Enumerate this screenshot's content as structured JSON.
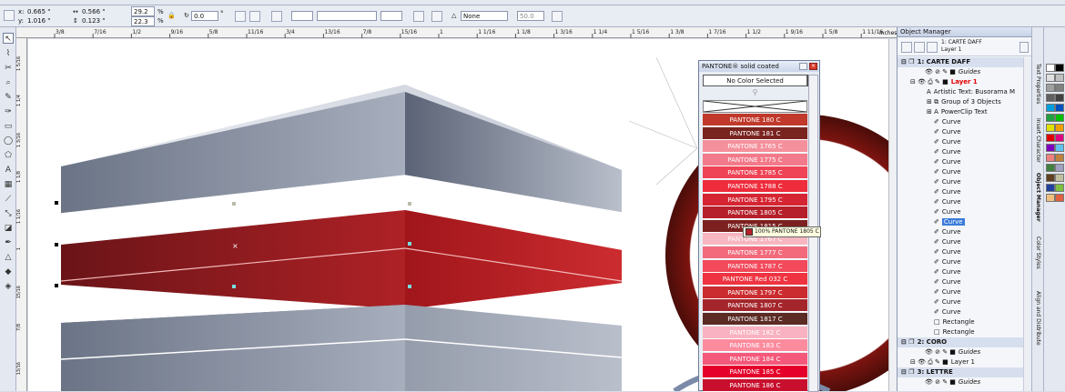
{
  "propbar": {
    "x_label": "x:",
    "x_value": "0.665 \"",
    "y_label": "y:",
    "y_value": "1.016 \"",
    "w_value": "0.566 \"",
    "h_value": "0.123 \"",
    "scale_w": "29.2",
    "scale_h": "22.3",
    "pct1": "%",
    "pct2": "%",
    "rotation": "0.0",
    "deg": "°",
    "outline_value": "None",
    "opacity_value": "50.0"
  },
  "ruler": {
    "units": "inches",
    "ticks": [
      "3/8",
      "7/16",
      "1/2",
      "9/16",
      "5/8",
      "11/16",
      "3/4",
      "13/16",
      "7/8",
      "15/16",
      "1",
      "1 1/16",
      "1 1/8",
      "1 3/16",
      "1 1/4",
      "1 5/16",
      "1 3/8",
      "1 7/16",
      "1 1/2",
      "1 9/16",
      "1 5/8",
      "1 11/16"
    ],
    "left_ticks": [
      "1 5/16",
      "1 1/4",
      "1 3/16",
      "1 1/8",
      "1 1/16",
      "1",
      "15/16",
      "7/8",
      "13/16"
    ]
  },
  "toolbox": {
    "tools": [
      "pick-tool",
      "shape-tool",
      "crop-tool",
      "zoom-tool",
      "freehand-tool",
      "smart-fill-tool",
      "rectangle-tool",
      "ellipse-tool",
      "polygon-tool",
      "text-tool",
      "table-tool",
      "dimension-tool",
      "connector-tool",
      "interactive-tool",
      "eyedropper-tool",
      "outline-tool",
      "fill-tool",
      "interactive-fill-tool"
    ]
  },
  "object_manager": {
    "title": "Object Manager",
    "current_page": "1: CARTE DAFF",
    "current_layer": "Layer 1",
    "tree": [
      {
        "type": "page",
        "label": "1: CARTE DAFF"
      },
      {
        "type": "guides",
        "label": "Guides"
      },
      {
        "type": "layer",
        "label": "Layer 1",
        "color": "#e00000"
      },
      {
        "type": "item",
        "label": "Artistic Text: Busorama M",
        "icon": "A"
      },
      {
        "type": "item",
        "label": "Group of 3 Objects",
        "icon": "G"
      },
      {
        "type": "item",
        "label": "PowerClip Text",
        "icon": "A"
      },
      {
        "type": "curve",
        "label": "Curve"
      },
      {
        "type": "curve",
        "label": "Curve"
      },
      {
        "type": "curve",
        "label": "Curve"
      },
      {
        "type": "curve",
        "label": "Curve"
      },
      {
        "type": "curve",
        "label": "Curve"
      },
      {
        "type": "curve",
        "label": "Curve"
      },
      {
        "type": "curve",
        "label": "Curve"
      },
      {
        "type": "curve",
        "label": "Curve"
      },
      {
        "type": "curve",
        "label": "Curve"
      },
      {
        "type": "curve",
        "label": "Curve"
      },
      {
        "type": "curve",
        "label": "Curve",
        "selected": true
      },
      {
        "type": "curve",
        "label": "Curve"
      },
      {
        "type": "curve",
        "label": "Curve"
      },
      {
        "type": "curve",
        "label": "Curve"
      },
      {
        "type": "curve",
        "label": "Curve"
      },
      {
        "type": "curve",
        "label": "Curve"
      },
      {
        "type": "curve",
        "label": "Curve"
      },
      {
        "type": "curve",
        "label": "Curve"
      },
      {
        "type": "curve",
        "label": "Curve"
      },
      {
        "type": "curve",
        "label": "Curve"
      },
      {
        "type": "rect",
        "label": "Rectangle"
      },
      {
        "type": "rect",
        "label": "Rectangle"
      },
      {
        "type": "page",
        "label": "2: CORO"
      },
      {
        "type": "guides",
        "label": "Guides"
      },
      {
        "type": "layer2",
        "label": "Layer 1"
      },
      {
        "type": "page",
        "label": "3: LETTRE"
      },
      {
        "type": "guides",
        "label": "Guides"
      }
    ]
  },
  "dockers": [
    "Text Properties",
    "Insert Character",
    "Object Manager",
    "Color Styles",
    "Align and Distribute"
  ],
  "palette": [
    "#ffffff",
    "#000000",
    "#e0e0e0",
    "#c0c0c0",
    "#a0a0a0",
    "#808080",
    "#606060",
    "#404040",
    "#00a0e0",
    "#0050c0",
    "#20a040",
    "#00c000",
    "#e0e000",
    "#f0a000",
    "#e00000",
    "#e00080",
    "#8000c0",
    "#60c0f0",
    "#f08080",
    "#c08040",
    "#408040",
    "#a0a0c0",
    "#604020",
    "#c0c0a0",
    "#2040a0",
    "#80c040",
    "#f0c080",
    "#e06040"
  ],
  "pantone": {
    "title": "PANTONE® solid coated",
    "select_label": "No Color Selected",
    "colors": [
      {
        "name": "PANTONE 180 C",
        "hex": "#c0392b"
      },
      {
        "name": "PANTONE 181 C",
        "hex": "#7a2420"
      },
      {
        "name": "PANTONE 1765 C",
        "hex": "#f4909c"
      },
      {
        "name": "PANTONE 1775 C",
        "hex": "#f37a8a"
      },
      {
        "name": "PANTONE 1785 C",
        "hex": "#ef4456"
      },
      {
        "name": "PANTONE 1788 C",
        "hex": "#ee2c3c"
      },
      {
        "name": "PANTONE 1795 C",
        "hex": "#d62532"
      },
      {
        "name": "PANTONE 1805 C",
        "hex": "#b5202a"
      },
      {
        "name": "PANTONE 1815 C",
        "hex": "#7c211f"
      },
      {
        "name": "PANTONE 1767 C",
        "hex": "#f7b6c0"
      },
      {
        "name": "PANTONE 1777 C",
        "hex": "#f26a7c"
      },
      {
        "name": "PANTONE 1787 C",
        "hex": "#f2495b"
      },
      {
        "name": "PANTONE Red 032 C",
        "hex": "#ef3340"
      },
      {
        "name": "PANTONE 1797 C",
        "hex": "#cb2c30"
      },
      {
        "name": "PANTONE 1807 C",
        "hex": "#a4262c"
      },
      {
        "name": "PANTONE 1817 C",
        "hex": "#5b2b24"
      },
      {
        "name": "PANTONE 182 C",
        "hex": "#f9b2c1"
      },
      {
        "name": "PANTONE 183 C",
        "hex": "#fc8b9e"
      },
      {
        "name": "PANTONE 184 C",
        "hex": "#f4587a"
      },
      {
        "name": "PANTONE 185 C",
        "hex": "#e4002b"
      },
      {
        "name": "PANTONE 186 C",
        "hex": "#c8102e"
      }
    ]
  },
  "tooltip": {
    "text": "100% PANTONE 1805 C"
  }
}
